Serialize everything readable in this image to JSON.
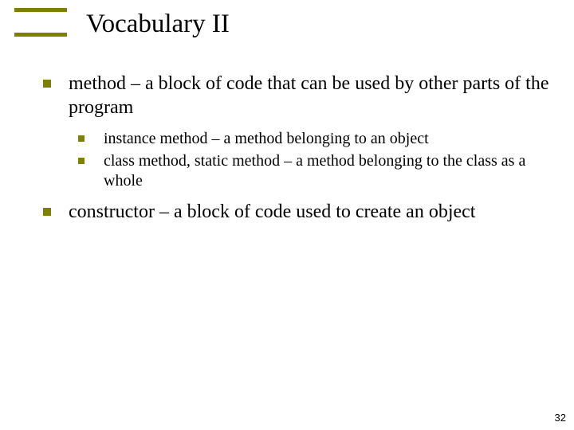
{
  "title": "Vocabulary II",
  "bullets": {
    "b1": "method – a block of code that can be used by other parts of the program",
    "b1_sub": {
      "s1": "instance method – a method belonging to an object",
      "s2": "class method, static method – a method belonging to the class as a whole"
    },
    "b2": "constructor – a block of code used to create an object"
  },
  "page_number": "32",
  "colors": {
    "accent": "#808000"
  }
}
